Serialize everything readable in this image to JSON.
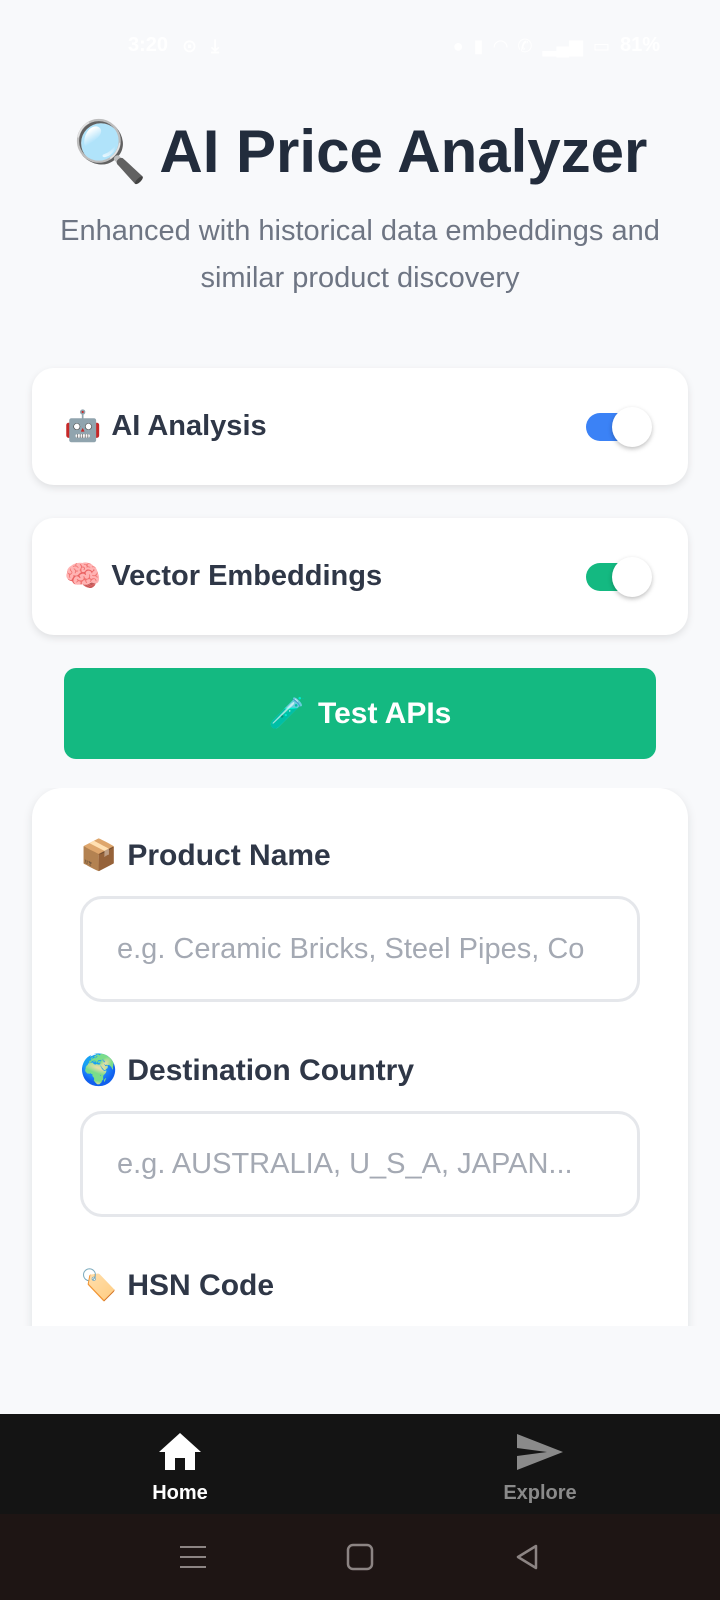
{
  "status_bar": {
    "time": "3:20",
    "battery": "81%",
    "left_icons": [
      "clock-icon",
      "download-icon"
    ],
    "right_icons": [
      "mute-icon",
      "network-icon",
      "wifi-icon",
      "call-icon",
      "signal-icon",
      "battery-icon"
    ]
  },
  "header": {
    "title_icon": "🔍",
    "title": "AI Price Analyzer",
    "subtitle": "Enhanced with historical data embeddings and similar product discovery"
  },
  "toggles": {
    "ai_analysis": {
      "icon": "🤖",
      "label": "AI Analysis",
      "enabled": true,
      "color": "#3b82f6"
    },
    "vector_embeddings": {
      "icon": "🧠",
      "label": "Vector Embeddings",
      "enabled": true,
      "color": "#14b981"
    }
  },
  "test_button": {
    "icon": "🧪",
    "label": "Test APIs",
    "color": "#14b981"
  },
  "form": {
    "product_name": {
      "icon": "📦",
      "label": "Product Name",
      "value": "",
      "placeholder": "e.g. Ceramic Bricks, Steel Pipes, Co"
    },
    "destination_country": {
      "icon": "🌍",
      "label": "Destination Country",
      "value": "",
      "placeholder": "e.g. AUSTRALIA, U_S_A, JAPAN..."
    },
    "hsn_code": {
      "icon": "🏷️",
      "label": "HSN Code"
    }
  },
  "bottom_nav": {
    "items": [
      {
        "label": "Home",
        "icon": "home-icon",
        "active": true
      },
      {
        "label": "Explore",
        "icon": "send-icon",
        "active": false
      }
    ]
  },
  "system_nav": [
    "menu-icon",
    "home-square-icon",
    "back-triangle-icon"
  ]
}
